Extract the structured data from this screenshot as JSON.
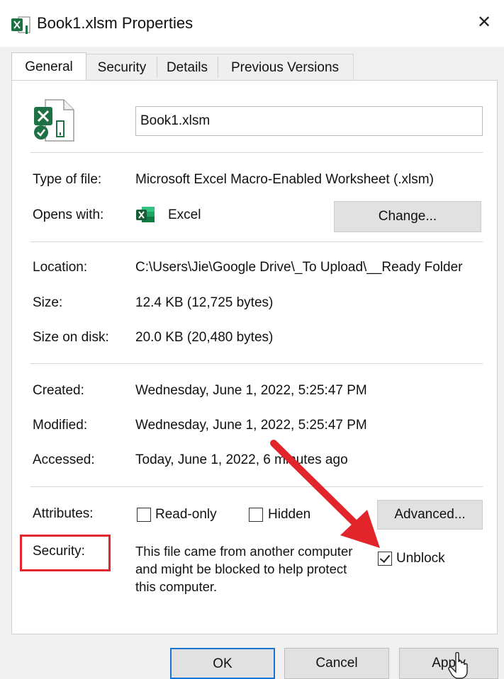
{
  "window": {
    "title": "Book1.xlsm Properties",
    "close_glyph": "✕"
  },
  "tabs": [
    {
      "label": "General",
      "active": true
    },
    {
      "label": "Security",
      "active": false
    },
    {
      "label": "Details",
      "active": false
    },
    {
      "label": "Previous Versions",
      "active": false
    }
  ],
  "general": {
    "filename": "Book1.xlsm",
    "type_label": "Type of file:",
    "type_value": "Microsoft Excel Macro-Enabled Worksheet (.xlsm)",
    "opens_label": "Opens with:",
    "opens_value": "Excel",
    "change_button": "Change...",
    "location_label": "Location:",
    "location_value": "C:\\Users\\Jie\\Google Drive\\_To Upload\\__Ready Folder",
    "size_label": "Size:",
    "size_value": "12.4 KB (12,725 bytes)",
    "size_disk_label": "Size on disk:",
    "size_disk_value": "20.0 KB (20,480 bytes)",
    "created_label": "Created:",
    "created_value": "Wednesday, June 1, 2022, 5:25:47 PM",
    "modified_label": "Modified:",
    "modified_value": "Wednesday, June 1, 2022, 5:25:47 PM",
    "accessed_label": "Accessed:",
    "accessed_value": "Today, June 1, 2022, 6 minutes ago",
    "attributes_label": "Attributes:",
    "readonly_label": "Read-only",
    "readonly_checked": false,
    "hidden_label": "Hidden",
    "hidden_checked": false,
    "advanced_button": "Advanced...",
    "security_label": "Security:",
    "security_text": "This file came from another computer and might be blocked to help protect this computer.",
    "unblock_label": "Unblock",
    "unblock_checked": true
  },
  "footer": {
    "ok": "OK",
    "cancel": "Cancel",
    "apply": "Apply"
  },
  "colors": {
    "highlight_red": "#e1252b",
    "excel_green": "#1d7145",
    "default_button_blue": "#1b73d1"
  }
}
